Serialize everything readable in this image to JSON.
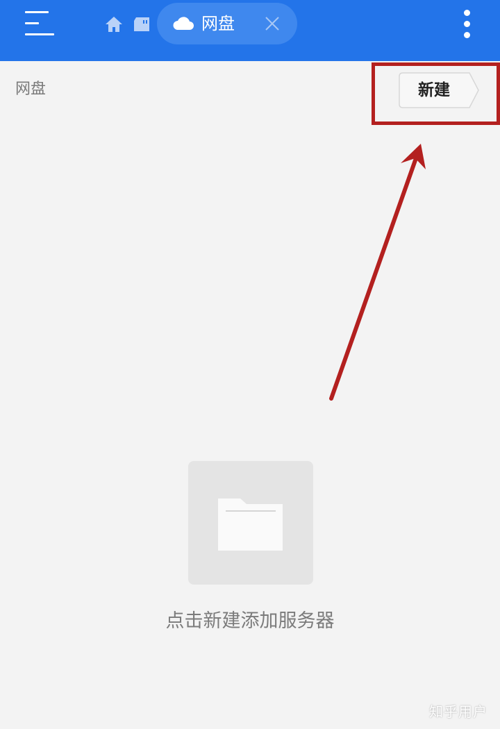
{
  "topbar": {
    "menu_icon": "hamburger-menu-icon",
    "home_icon": "home-icon",
    "storage_icon": "storage-card-icon",
    "active_tab": {
      "icon": "cloud-icon",
      "label": "网盘",
      "close_icon": "close-icon"
    },
    "more_icon": "more-vertical-icon",
    "background_color": "#2374e9"
  },
  "breadcrumb": {
    "current": "网盘"
  },
  "new_button": {
    "label": "新建"
  },
  "annotation": {
    "color": "#b3201f"
  },
  "empty_state": {
    "icon": "folder-icon",
    "message": "点击新建添加服务器"
  },
  "watermark": {
    "text": "知乎用户"
  }
}
